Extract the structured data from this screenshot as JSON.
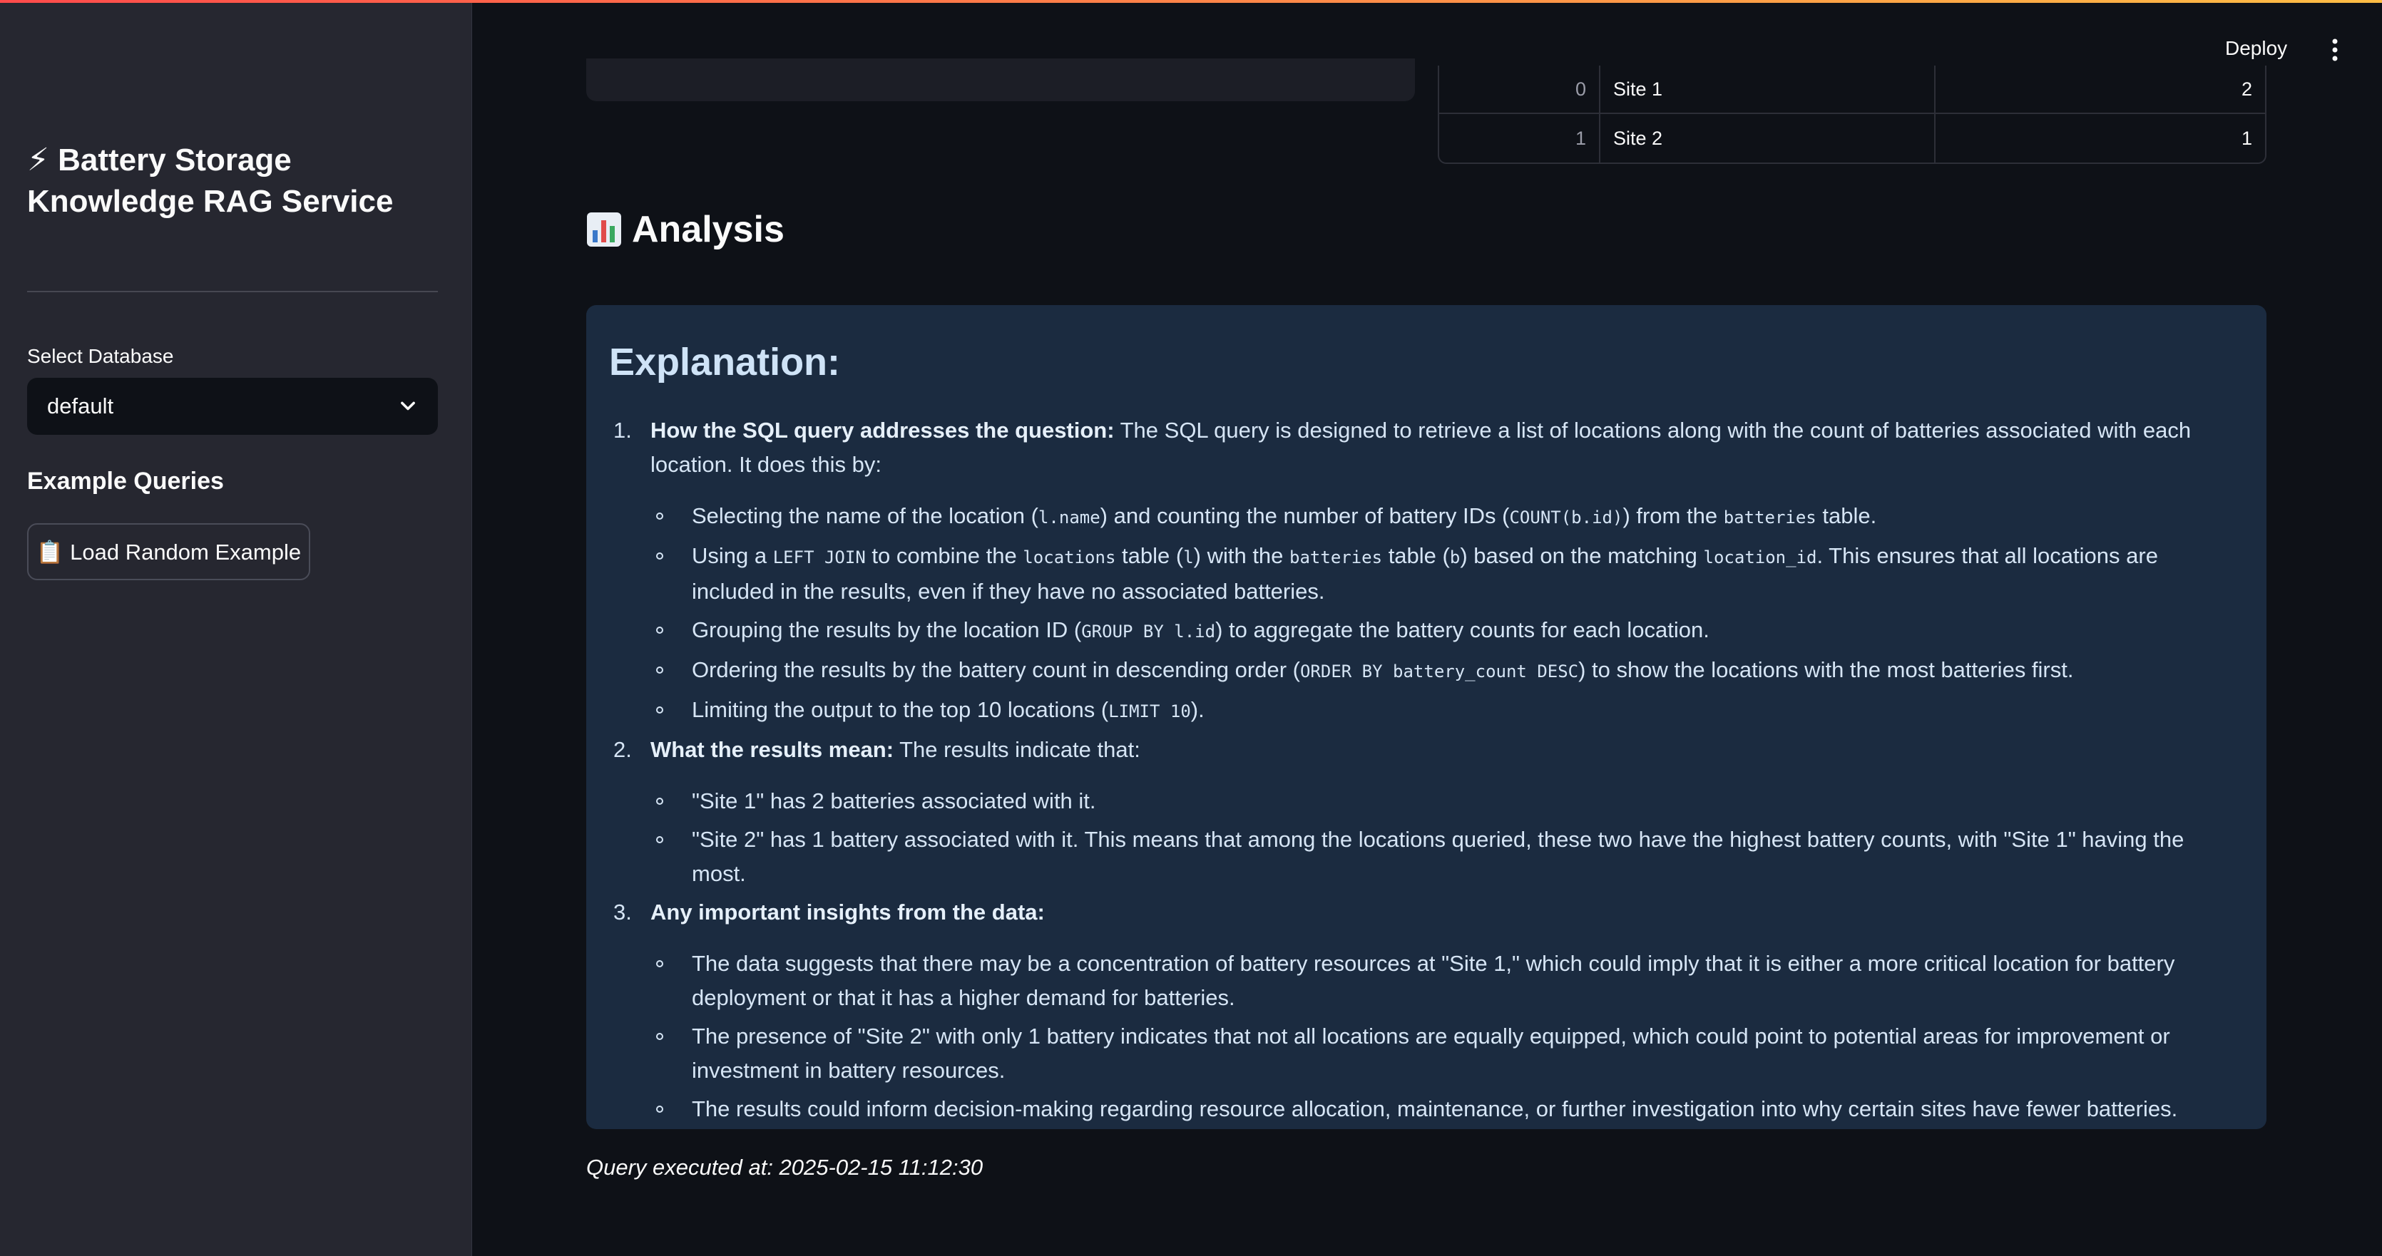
{
  "sidebar": {
    "title_icon": "lightning-icon",
    "title": "⚡ Battery Storage Knowledge RAG Service",
    "select_label": "Select Database",
    "select_value": "default",
    "examples_heading": "Example Queries",
    "load_button": "📋 Load Random Example"
  },
  "header": {
    "deploy": "Deploy"
  },
  "results_table": {
    "rows": [
      {
        "index": "0",
        "name": "Site 1",
        "count": "2"
      },
      {
        "index": "1",
        "name": "Site 2",
        "count": "1"
      }
    ]
  },
  "analysis": {
    "title": "Analysis",
    "icon": "bar-chart-icon"
  },
  "explanation": {
    "title": "Explanation:",
    "sections": [
      {
        "num": "1.",
        "heading": "How the SQL query addresses the question:",
        "text": " The SQL query is designed to retrieve a list of locations along with the count of batteries associated with each location. It does this by:",
        "bullets": [
          [
            {
              "t": "Selecting the name of the location ("
            },
            {
              "c": "l.name"
            },
            {
              "t": ") and counting the number of battery IDs ("
            },
            {
              "c": "COUNT(b.id)"
            },
            {
              "t": ") from the "
            },
            {
              "c": "batteries"
            },
            {
              "t": " table."
            }
          ],
          [
            {
              "t": "Using a "
            },
            {
              "c": "LEFT JOIN"
            },
            {
              "t": " to combine the "
            },
            {
              "c": "locations"
            },
            {
              "t": " table ("
            },
            {
              "c": "l"
            },
            {
              "t": ") with the "
            },
            {
              "c": "batteries"
            },
            {
              "t": " table ("
            },
            {
              "c": "b"
            },
            {
              "t": ") based on the matching "
            },
            {
              "c": "location_id"
            },
            {
              "t": ". This ensures that all locations are included in the results, even if they have no associated batteries."
            }
          ],
          [
            {
              "t": "Grouping the results by the location ID ("
            },
            {
              "c": "GROUP BY l.id"
            },
            {
              "t": ") to aggregate the battery counts for each location."
            }
          ],
          [
            {
              "t": "Ordering the results by the battery count in descending order ("
            },
            {
              "c": "ORDER BY battery_count DESC"
            },
            {
              "t": ") to show the locations with the most batteries first."
            }
          ],
          [
            {
              "t": "Limiting the output to the top 10 locations ("
            },
            {
              "c": "LIMIT 10"
            },
            {
              "t": ")."
            }
          ]
        ]
      },
      {
        "num": "2.",
        "heading": "What the results mean:",
        "text": " The results indicate that:",
        "bullets": [
          [
            {
              "t": "\"Site 1\" has 2 batteries associated with it."
            }
          ],
          [
            {
              "t": "\"Site 2\" has 1 battery associated with it. This means that among the locations queried, these two have the highest battery counts, with \"Site 1\" having the most."
            }
          ]
        ]
      },
      {
        "num": "3.",
        "heading": "Any important insights from the data:",
        "text": "",
        "bullets": [
          [
            {
              "t": "The data suggests that there may be a concentration of battery resources at \"Site 1,\" which could imply that it is either a more critical location for battery deployment or that it has a higher demand for batteries."
            }
          ],
          [
            {
              "t": "The presence of \"Site 2\" with only 1 battery indicates that not all locations are equally equipped, which could point to potential areas for improvement or investment in battery resources."
            }
          ],
          [
            {
              "t": "The results could inform decision-making regarding resource allocation, maintenance, or further investigation into why certain sites have fewer batteries."
            }
          ]
        ]
      }
    ]
  },
  "footer": {
    "executed": "Query executed at: 2025-02-15 11:12:30"
  }
}
